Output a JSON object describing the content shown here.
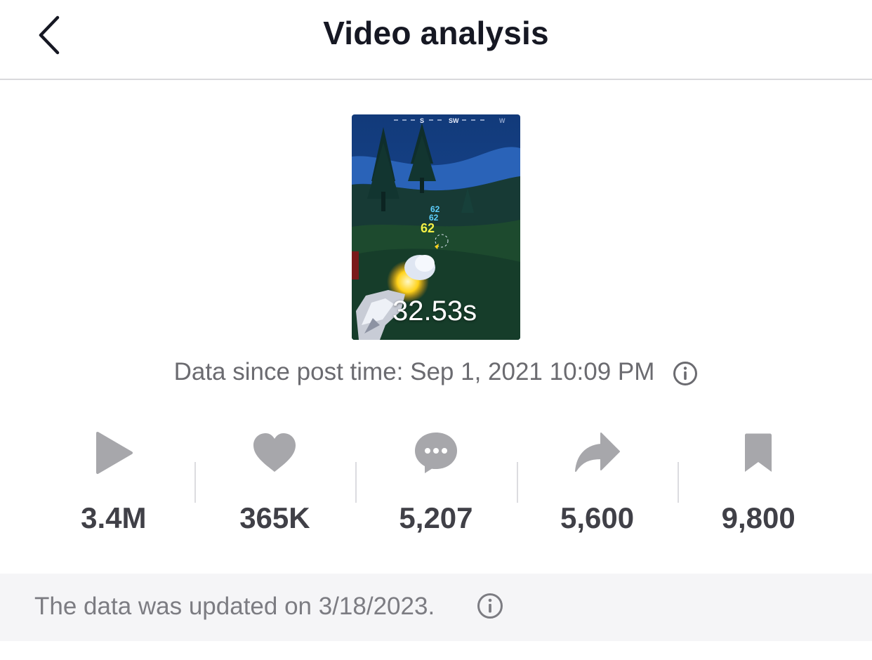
{
  "header": {
    "title": "Video analysis",
    "back_icon": "chevron-left-icon"
  },
  "video": {
    "duration": "32.53s",
    "thumbnail_overlay": {
      "compass": [
        "S",
        "SW",
        "W"
      ],
      "damage_numbers": [
        "62",
        "62",
        "62"
      ]
    }
  },
  "post_time": {
    "text": "Data since post time: Sep 1, 2021 10:09 PM",
    "icon": "info-icon"
  },
  "stats": [
    {
      "id": "views",
      "icon": "play-icon",
      "value": "3.4M"
    },
    {
      "id": "likes",
      "icon": "heart-icon",
      "value": "365K"
    },
    {
      "id": "comments",
      "icon": "comment-icon",
      "value": "5,207"
    },
    {
      "id": "shares",
      "icon": "share-icon",
      "value": "5,600"
    },
    {
      "id": "saves",
      "icon": "bookmark-icon",
      "value": "9,800"
    }
  ],
  "footer": {
    "text": "The data was updated on 3/18/2023.",
    "icon": "info-icon"
  },
  "colors": {
    "title": "#161823",
    "icon_gray": "#a7a7ab",
    "value_text": "#404047",
    "secondary_text": "#6b6b70",
    "footer_bg": "#f5f5f7"
  }
}
